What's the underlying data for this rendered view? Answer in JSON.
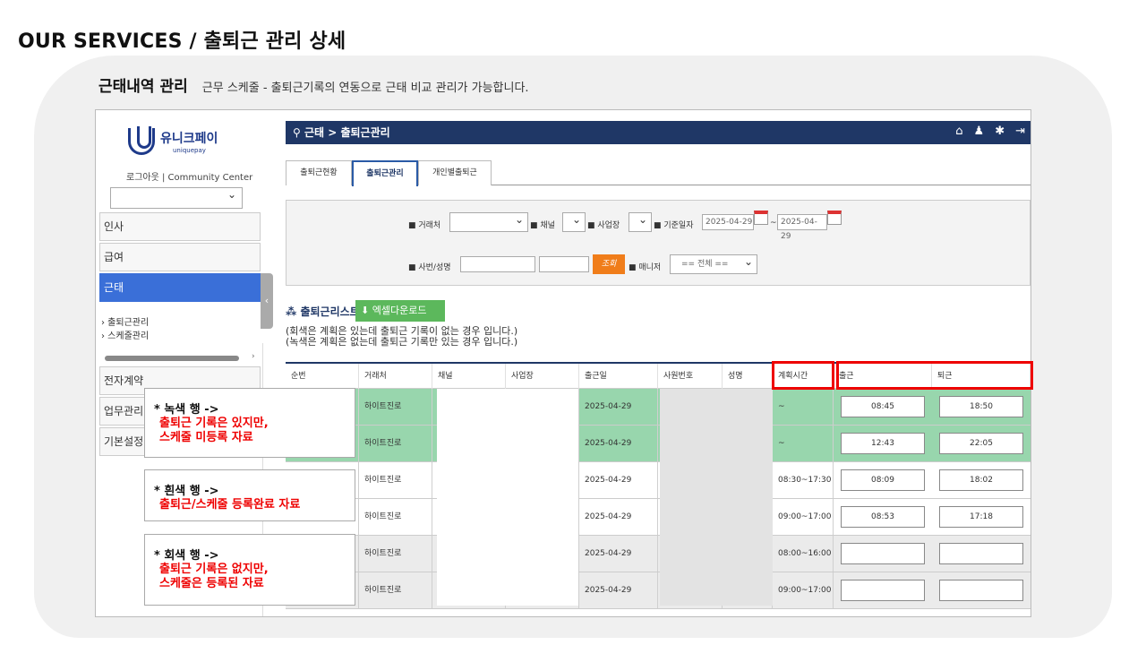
{
  "page_title": "OUR SERVICES / 출퇴근 관리 상세",
  "subhead": {
    "strong": "근태내역 관리",
    "desc": "근무 스케줄  -  출퇴근기록의 연동으로 근태 비교 관리가 가능합니다."
  },
  "logo": {
    "korean": "유니크페이",
    "english": "uniquepay"
  },
  "logout_line": "로그아웃 | Community Center",
  "sidebar": {
    "menus": [
      "인사",
      "급여",
      "근태",
      "전자계약",
      "업무관리",
      "기본설정"
    ],
    "submenus": [
      "› 출퇴근관리",
      "› 스케줄관리"
    ]
  },
  "topbar": {
    "crumb": "⚲ 근태 > 출퇴근관리",
    "icons": [
      "⌂",
      "♟",
      "✱",
      "⇥"
    ]
  },
  "tabs": [
    "출퇴근현황",
    "출퇴근관리",
    "개인별출퇴근"
  ],
  "filter": {
    "client_label": "■ 거래처",
    "channel_label": "■ 채널",
    "site_label": "■ 사업장",
    "date_label": "■ 기준일자",
    "date_from": "2025-04-29",
    "date_sep": "~",
    "date_to": "2025-04-29",
    "emp_label": "■ 사번/성명",
    "search_btn": "조회",
    "manager_label": "■ 매니저",
    "manager_value": "== 전체 =="
  },
  "list": {
    "title": "⁂ 출퇴근리스트",
    "excel_btn": "⬇ 엑셀다운로드",
    "note1": "(회색은 계획은 있는데 출퇴근 기록이 없는 경우 입니다.)",
    "note2": "(녹색은 계획은 없는데 출퇴근 기록만 있는 경우 입니다.)"
  },
  "columns": [
    "순번",
    "거래처",
    "채널",
    "사업장",
    "출근일",
    "사원번호",
    "성명",
    "계획시간",
    "출근",
    "퇴근"
  ],
  "rows": [
    {
      "client": "하이트진로",
      "date": "2025-04-29",
      "plan": "~",
      "in": "08:45",
      "out": "18:50",
      "tone": "green"
    },
    {
      "client": "하이트진로",
      "date": "2025-04-29",
      "plan": "~",
      "in": "12:43",
      "out": "22:05",
      "tone": "green"
    },
    {
      "client": "하이트진로",
      "date": "2025-04-29",
      "plan": "08:30~17:30",
      "in": "08:09",
      "out": "18:02",
      "tone": "white"
    },
    {
      "client": "하이트진로",
      "date": "2025-04-29",
      "plan": "09:00~17:00",
      "in": "08:53",
      "out": "17:18",
      "tone": "white"
    },
    {
      "client": "하이트진로",
      "date": "2025-04-29",
      "plan": "08:00~16:00",
      "in": "",
      "out": "",
      "tone": "gray"
    },
    {
      "client": "하이트진로",
      "date": "2025-04-29",
      "plan": "09:00~17:00",
      "in": "",
      "out": "",
      "tone": "gray"
    }
  ],
  "callouts": [
    {
      "head": "* 녹색 행 ->",
      "line1": "출퇴근 기록은 있지만,",
      "line2": "스케줄 미등록 자료"
    },
    {
      "head": "* 흰색 행 ->",
      "line1": "출퇴근/스케줄 등록완료 자료",
      "line2": ""
    },
    {
      "head": "* 회색 행 ->",
      "line1": "출퇴근 기록은 없지만,",
      "line2": "스케줄은 등록된 자료"
    }
  ]
}
